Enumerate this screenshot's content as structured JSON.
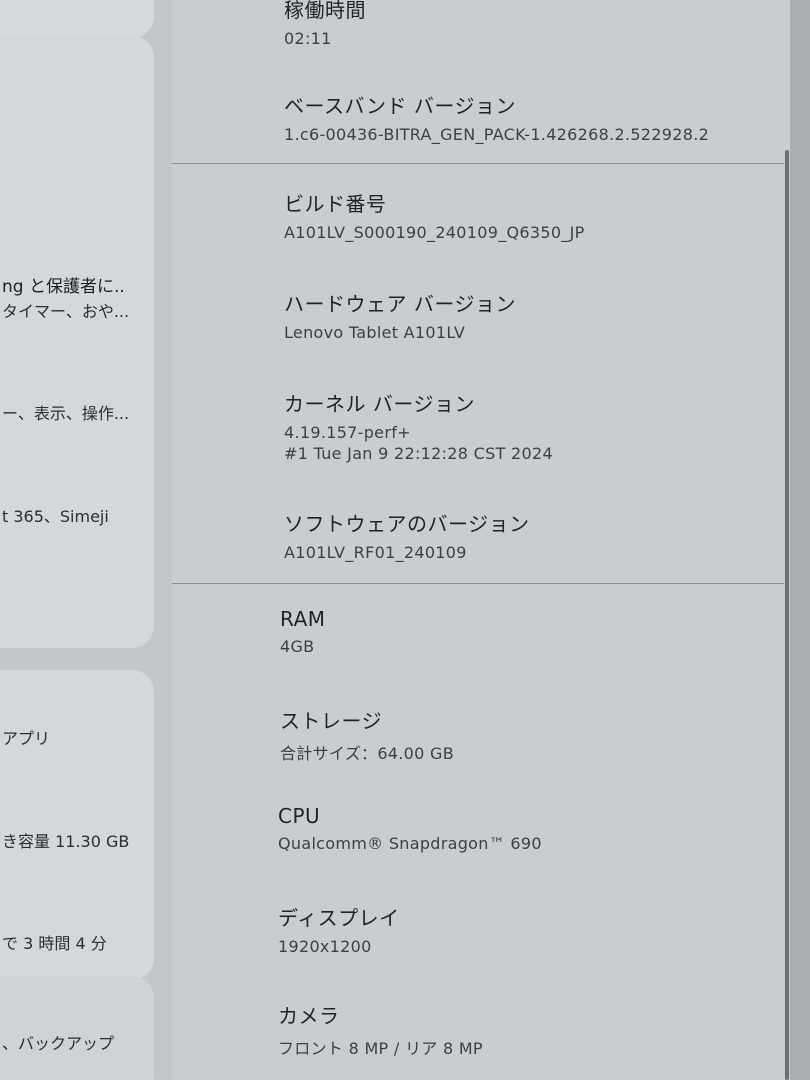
{
  "sidebar": {
    "snippets": [
      "ng と保護者に..",
      "タイマー、おや...",
      "ー、表示、操作...",
      "t 365、Simeji",
      "アプリ",
      "き容量 11.30 GB",
      "で 3 時間 4 分",
      "、バックアップ"
    ]
  },
  "about": {
    "uptime": {
      "title": "稼働時間",
      "value": "02:11"
    },
    "baseband": {
      "title": "ベースバンド バージョン",
      "value": "1.c6-00436-BITRA_GEN_PACK-1.426268.2.522928.2"
    },
    "build": {
      "title": "ビルド番号",
      "value": "A101LV_S000190_240109_Q6350_JP"
    },
    "hardware": {
      "title": "ハードウェア バージョン",
      "value": "Lenovo Tablet A101LV"
    },
    "kernel": {
      "title": "カーネル バージョン",
      "value": "4.19.157-perf+",
      "value2": "#1 Tue Jan 9 22:12:28 CST 2024"
    },
    "software": {
      "title": "ソフトウェアのバージョン",
      "value": "A101LV_RF01_240109"
    },
    "ram": {
      "title": "RAM",
      "value": "4GB"
    },
    "storage": {
      "title": "ストレージ",
      "value": "合計サイズ：64.00 GB"
    },
    "cpu": {
      "title": "CPU",
      "value": "Qualcomm® Snapdragon™ 690"
    },
    "display": {
      "title": "ディスプレイ",
      "value": "1920x1200"
    },
    "camera": {
      "title": "カメラ",
      "value": "フロント 8 MP / リア 8 MP"
    }
  }
}
